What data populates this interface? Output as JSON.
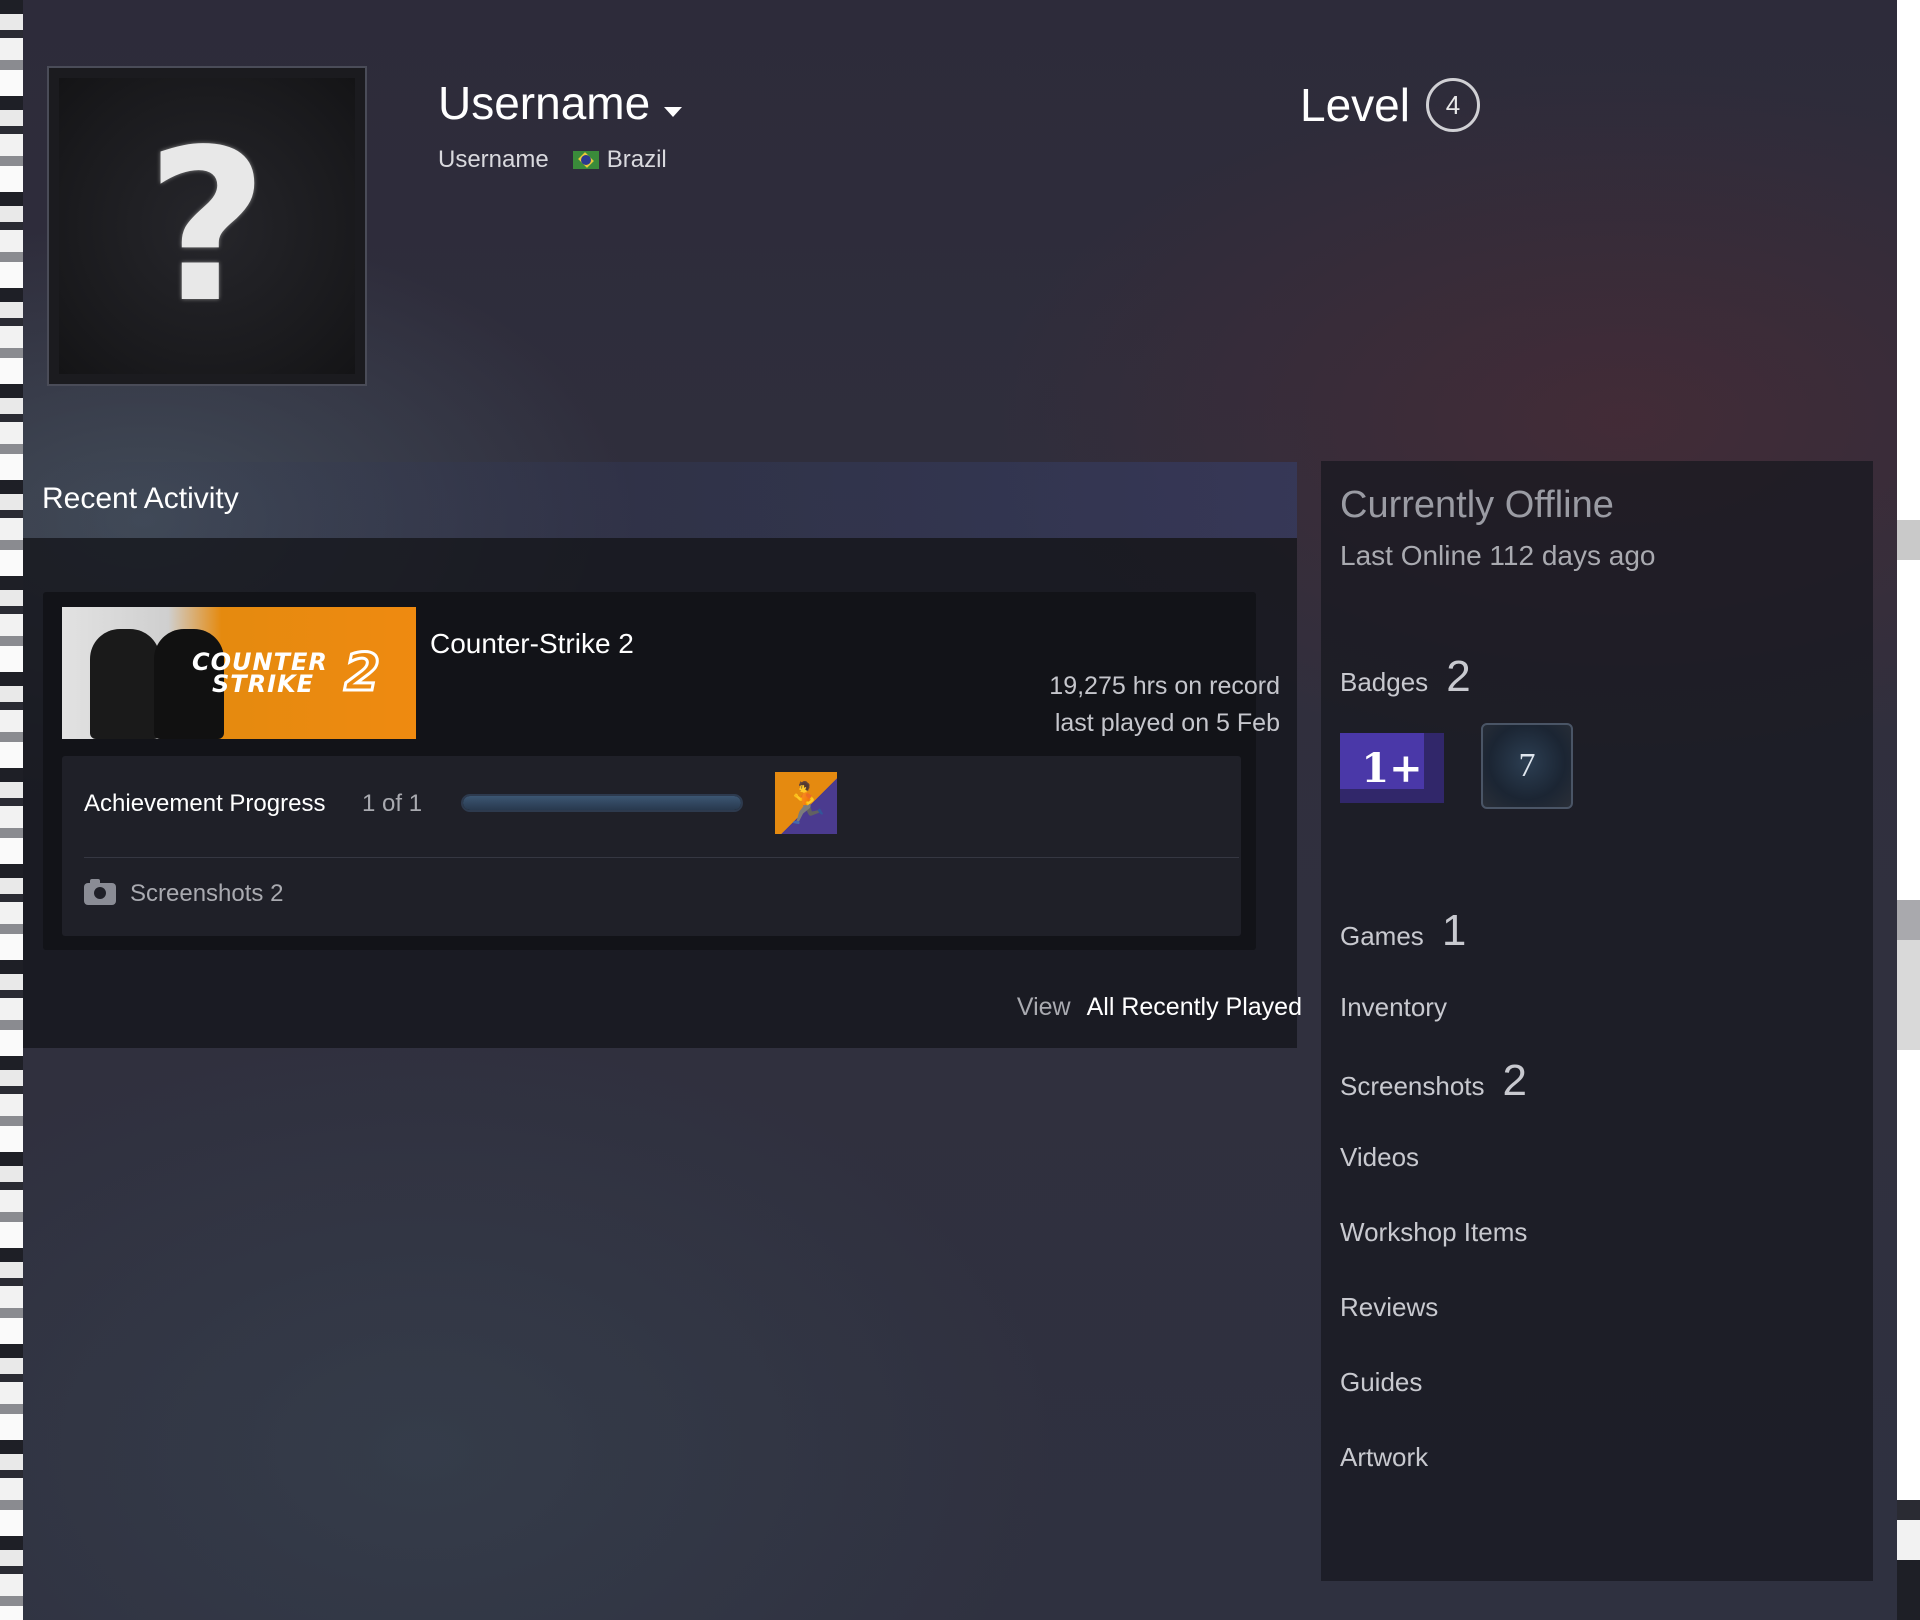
{
  "profile": {
    "persona_name": "Username",
    "real_name": "Username",
    "country": "Brazil",
    "level_label": "Level",
    "level": "4",
    "avatar_glyph": "?"
  },
  "recent_activity": {
    "title": "Recent Activity",
    "game": {
      "name": "Counter-Strike 2",
      "capsule_text_line1": "COUNTER",
      "capsule_text_line2": "STRIKE",
      "capsule_number": "2",
      "hours": "19,275 hrs on record",
      "last_played": "last played on 5 Feb",
      "achievement_label": "Achievement Progress",
      "achievement_count": "1 of 1",
      "achievement_progress": 1.0,
      "screenshots": "Screenshots 2"
    },
    "view_label": "View",
    "view_link": "All Recently Played"
  },
  "status": {
    "state": "Currently Offline",
    "last_online": "Last Online 112 days ago"
  },
  "stats": {
    "badges_label": "Badges",
    "badges_count": "2",
    "badge1_text": "1+",
    "badge2_text": "7",
    "games_label": "Games",
    "games_count": "1",
    "inventory": "Inventory",
    "screenshots_label": "Screenshots",
    "screenshots_count": "2",
    "videos": "Videos",
    "workshop": "Workshop Items",
    "reviews": "Reviews",
    "guides": "Guides",
    "artwork": "Artwork"
  },
  "colors": {
    "background": "#2f2f3d",
    "accent_orange": "#e58a10",
    "badge_purple": "#4a38a8"
  }
}
